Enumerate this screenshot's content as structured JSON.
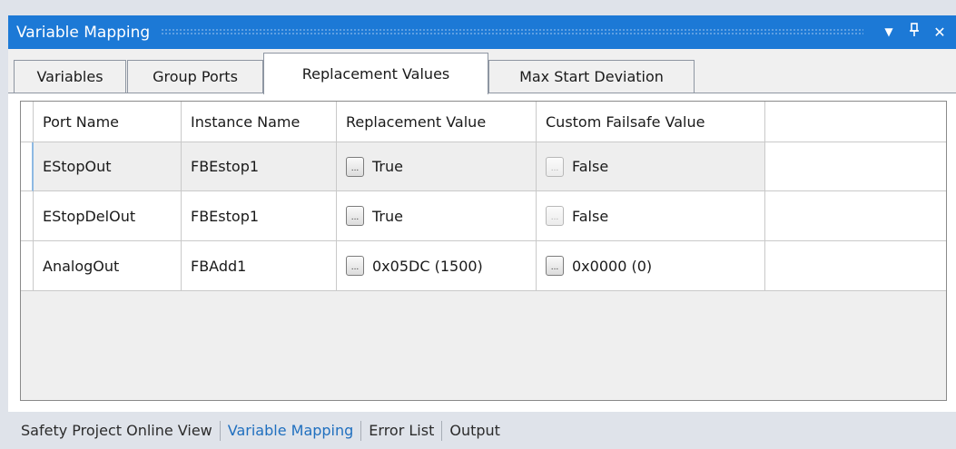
{
  "panel": {
    "title": "Variable Mapping",
    "controls": {
      "dropdown": "▼",
      "pin": "ᵽ",
      "close": "✕"
    }
  },
  "tabs": [
    {
      "label": "Variables",
      "active": false
    },
    {
      "label": "Group Ports",
      "active": false
    },
    {
      "label": "Replacement Values",
      "active": true
    },
    {
      "label": "Max Start Deviation",
      "active": false
    }
  ],
  "table": {
    "columns": [
      "Port Name",
      "Instance Name",
      "Replacement Value",
      "Custom Failsafe Value"
    ],
    "rows": [
      {
        "port_name": "EStopOut",
        "instance_name": "FBEstop1",
        "replacement_value": "True",
        "replacement_button_enabled": true,
        "failsafe_value": "False",
        "failsafe_button_enabled": false
      },
      {
        "port_name": "EStopDelOut",
        "instance_name": "FBEstop1",
        "replacement_value": "True",
        "replacement_button_enabled": true,
        "failsafe_value": "False",
        "failsafe_button_enabled": false
      },
      {
        "port_name": "AnalogOut",
        "instance_name": "FBAdd1",
        "replacement_value": "0x05DC (1500)",
        "replacement_button_enabled": true,
        "failsafe_value": "0x0000 (0)",
        "failsafe_button_enabled": true
      }
    ],
    "ellipsis": "..."
  },
  "bottom_tabs": [
    {
      "label": "Safety Project Online View",
      "active": false
    },
    {
      "label": "Variable Mapping",
      "active": true
    },
    {
      "label": "Error List",
      "active": false
    },
    {
      "label": "Output",
      "active": false
    }
  ],
  "colors": {
    "title_bar": "#1c79d6",
    "active_bottom_tab": "#1f6fbf",
    "frame": "#dfe3ea"
  }
}
